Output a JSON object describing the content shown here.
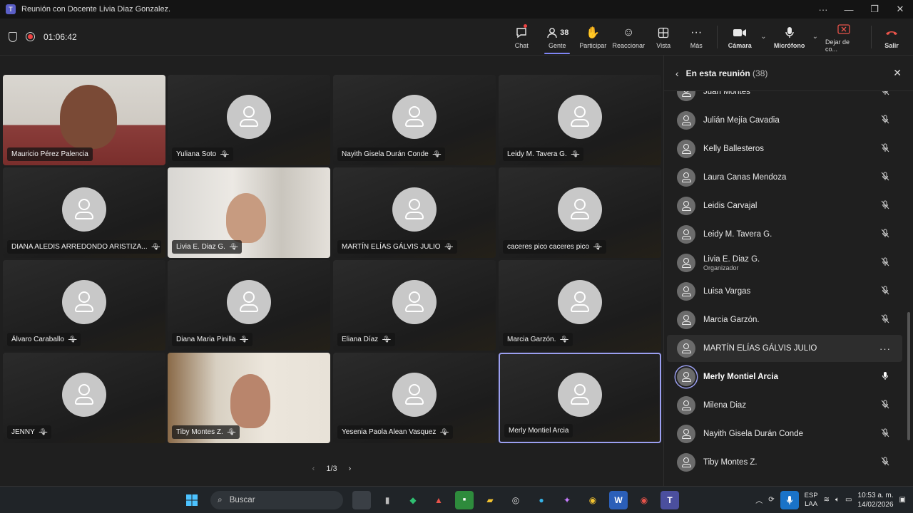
{
  "window": {
    "title": "Reunión con Docente Livia Diaz Gonzalez."
  },
  "toolbar": {
    "timer": "01:06:42",
    "chat": "Chat",
    "people": "Gente",
    "people_count": "38",
    "raise": "Participar",
    "react": "Reaccionar",
    "view": "Vista",
    "more": "Más",
    "camera": "Cámara",
    "mic": "Micrófono",
    "share": "Dejar de co...",
    "leave": "Salir"
  },
  "tiles": [
    {
      "name": "Mauricio Pérez Palencia",
      "video": true,
      "muted": false
    },
    {
      "name": "Yuliana Soto",
      "video": false,
      "muted": true
    },
    {
      "name": "Nayith Gisela Durán Conde",
      "video": false,
      "muted": true
    },
    {
      "name": "Leidy M. Tavera G.",
      "video": false,
      "muted": true
    },
    {
      "name": "DIANA ALEDIS ARREDONDO ARISTIZA...",
      "video": false,
      "muted": true
    },
    {
      "name": "Livia E. Diaz G.",
      "video": true,
      "muted": true
    },
    {
      "name": "MARTÍN ELÍAS GÁLVIS JULIO",
      "video": false,
      "muted": true
    },
    {
      "name": "caceres pico caceres pico",
      "video": false,
      "muted": true
    },
    {
      "name": "Álvaro Caraballo",
      "video": false,
      "muted": true
    },
    {
      "name": "Diana Maria Pinilla",
      "video": false,
      "muted": true
    },
    {
      "name": "Eliana Díaz",
      "video": false,
      "muted": true
    },
    {
      "name": "Marcia Garzón.",
      "video": false,
      "muted": true
    },
    {
      "name": "JENNY",
      "video": false,
      "muted": true
    },
    {
      "name": "Tiby Montes Z.",
      "video": true,
      "muted": true
    },
    {
      "name": "Yesenia Paola Alean Vasquez",
      "video": false,
      "muted": true
    },
    {
      "name": "Merly Montiel Arcia",
      "video": false,
      "muted": false
    }
  ],
  "pager": {
    "label": "1/3"
  },
  "panel": {
    "title": "En esta reunión",
    "count": "(38)",
    "participants": [
      {
        "name": "Juan Montes",
        "role": ""
      },
      {
        "name": "Julián Mejía Cavadia",
        "role": ""
      },
      {
        "name": "Kelly Ballesteros",
        "role": ""
      },
      {
        "name": "Laura Canas Mendoza",
        "role": ""
      },
      {
        "name": "Leidis Carvajal",
        "role": ""
      },
      {
        "name": "Leidy M. Tavera G.",
        "role": ""
      },
      {
        "name": "Livia E. Diaz G.",
        "role": "Organizador"
      },
      {
        "name": "Luisa Vargas",
        "role": ""
      },
      {
        "name": "Marcia Garzón.",
        "role": ""
      },
      {
        "name": "MARTÍN ELÍAS GÁLVIS JULIO",
        "role": ""
      },
      {
        "name": "Merly Montiel Arcia",
        "role": ""
      },
      {
        "name": "Milena Diaz",
        "role": ""
      },
      {
        "name": "Nayith Gisela Durán Conde",
        "role": ""
      },
      {
        "name": "Tiby Montes Z.",
        "role": ""
      }
    ]
  },
  "taskbar": {
    "search": "Buscar",
    "lang1": "ESP",
    "lang2": "LAA",
    "time": "10:53 a. m.",
    "date": "14/02/2026"
  },
  "colors": {
    "accent": "#7f85f5",
    "leave": "#e8534a",
    "bg": "#1f1f1f"
  }
}
